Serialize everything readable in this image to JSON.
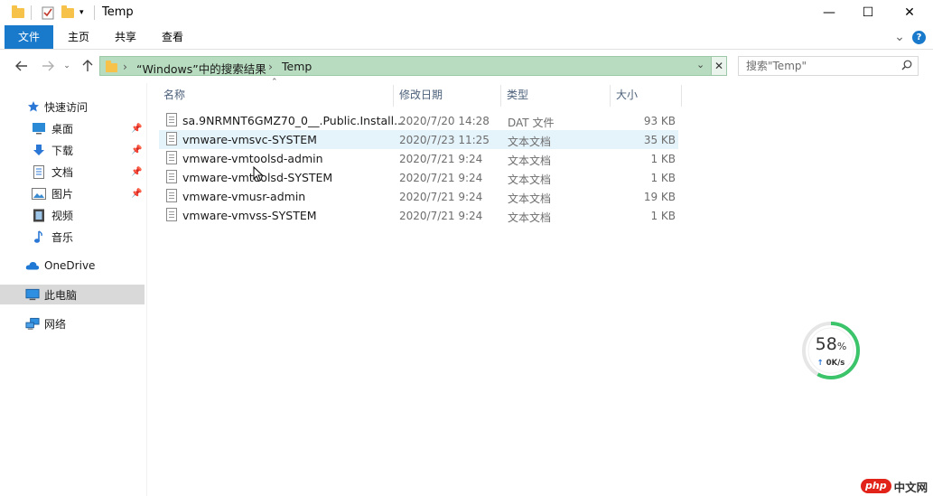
{
  "window": {
    "title": "Temp",
    "minimize_glyph": "—",
    "maximize_glyph": "☐",
    "close_glyph": "✕"
  },
  "ribbon": {
    "tabs": [
      {
        "label": "文件"
      },
      {
        "label": "主页"
      },
      {
        "label": "共享"
      },
      {
        "label": "查看"
      }
    ],
    "expand_glyph": "⌄",
    "help_glyph": "?"
  },
  "address": {
    "crumbs": [
      "“Windows”中的搜索结果",
      "Temp"
    ],
    "separator": "›"
  },
  "search": {
    "placeholder": "搜索\"Temp\""
  },
  "sidebar": {
    "items": [
      {
        "label": "快速访问",
        "icon": "star-icon"
      },
      {
        "label": "桌面",
        "icon": "desktop-icon",
        "pinned": true
      },
      {
        "label": "下载",
        "icon": "download-icon",
        "pinned": true
      },
      {
        "label": "文档",
        "icon": "documents-icon",
        "pinned": true
      },
      {
        "label": "图片",
        "icon": "pictures-icon",
        "pinned": true
      },
      {
        "label": "视频",
        "icon": "videos-icon"
      },
      {
        "label": "音乐",
        "icon": "music-icon"
      },
      {
        "label": "OneDrive",
        "icon": "onedrive-icon"
      },
      {
        "label": "此电脑",
        "icon": "this-pc-icon",
        "selected": true
      },
      {
        "label": "网络",
        "icon": "network-icon"
      }
    ]
  },
  "file_list": {
    "columns": [
      "名称",
      "修改日期",
      "类型",
      "大小"
    ],
    "rows": [
      {
        "name": "sa.9NRMNT6GMZ70_0__.Public.Install...",
        "date": "2020/7/20 14:28",
        "type": "DAT 文件",
        "size": "93 KB"
      },
      {
        "name": "vmware-vmsvc-SYSTEM",
        "date": "2020/7/23 11:25",
        "type": "文本文档",
        "size": "35 KB"
      },
      {
        "name": "vmware-vmtoolsd-admin",
        "date": "2020/7/21 9:24",
        "type": "文本文档",
        "size": "1 KB"
      },
      {
        "name": "vmware-vmtoolsd-SYSTEM",
        "date": "2020/7/21 9:24",
        "type": "文本文档",
        "size": "1 KB"
      },
      {
        "name": "vmware-vmusr-admin",
        "date": "2020/7/21 9:24",
        "type": "文本文档",
        "size": "19 KB"
      },
      {
        "name": "vmware-vmvss-SYSTEM",
        "date": "2020/7/21 9:24",
        "type": "文本文档",
        "size": "1 KB"
      }
    ]
  },
  "speed_widget": {
    "percent_value": "58",
    "percent_sign": "%",
    "arrow": "↑",
    "rate": "0K/s",
    "fraction": 0.58
  },
  "watermark": {
    "badge": "php",
    "text": "中文网"
  },
  "colors": {
    "file_tab": "#1979ca",
    "address_bar": "#b7dcbf",
    "hover_row": "#e5f3fb",
    "selected_nav": "#d9d9d9",
    "speed_ring": "#3cc46b"
  }
}
